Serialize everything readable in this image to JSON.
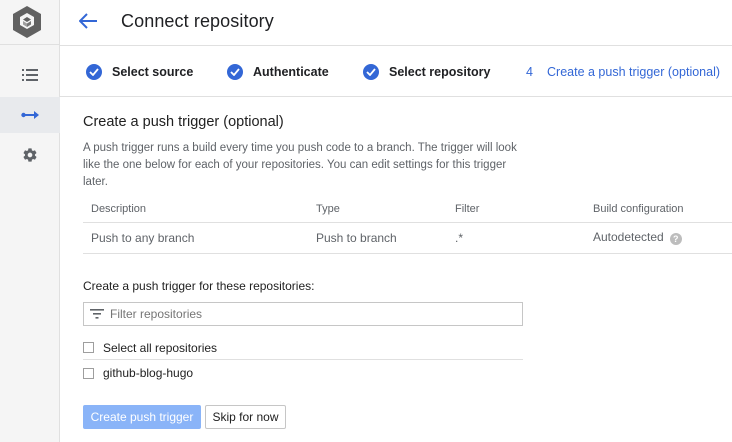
{
  "app": {
    "title": "Connect repository",
    "accent": "#3367d6",
    "logo_icon": "cloud-build-hexagon-icon"
  },
  "rail": {
    "items": [
      {
        "icon": "list-icon",
        "active": false
      },
      {
        "icon": "arrow-connection-icon",
        "active": true
      },
      {
        "icon": "gear-icon",
        "active": false
      }
    ]
  },
  "header": {
    "back_icon": "arrow-back-icon",
    "title": "Connect repository"
  },
  "stepper": {
    "steps": [
      {
        "label": "Select source",
        "state": "complete"
      },
      {
        "label": "Authenticate",
        "state": "complete"
      },
      {
        "label": "Select repository",
        "state": "complete"
      },
      {
        "number": "4",
        "label": "Create a push trigger (optional)",
        "state": "current"
      }
    ]
  },
  "main": {
    "section_title": "Create a push trigger (optional)",
    "description": "A push trigger runs a build every time you push code to a branch. The trigger will look like the one below for each of your repositories. You can edit settings for this trigger later.",
    "table": {
      "headers": [
        "Description",
        "Type",
        "Filter",
        "Build configuration"
      ],
      "rows": [
        [
          "Push to any branch",
          "Push to branch",
          ".*",
          "Autodetected"
        ]
      ]
    },
    "repo_heading": "Create a push trigger for these repositories:",
    "filter": {
      "placeholder": "Filter repositories",
      "value": ""
    },
    "select_all_label": "Select all repositories",
    "repos": [
      "github-blog-hugo"
    ],
    "primary_button": "Create push trigger",
    "secondary_button": "Skip for now"
  }
}
